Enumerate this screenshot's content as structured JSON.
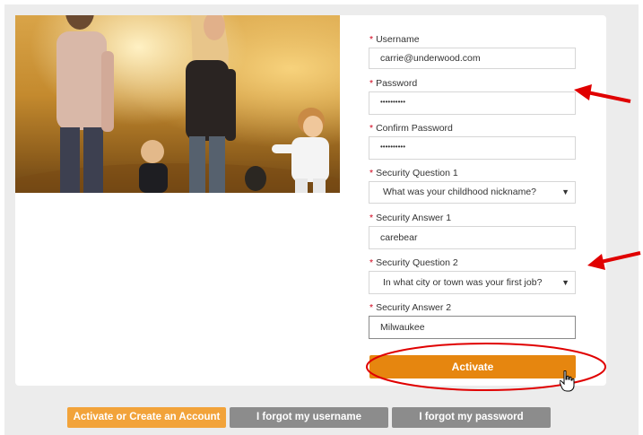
{
  "form": {
    "username": {
      "label": "Username",
      "value": "carrie@underwood.com"
    },
    "password": {
      "label": "Password",
      "value": "••••••••••"
    },
    "confirm_password": {
      "label": "Confirm Password",
      "value": "••••••••••"
    },
    "security_question_1": {
      "label": "Security Question 1",
      "selected": "What was your childhood nickname?"
    },
    "security_answer_1": {
      "label": "Security Answer 1",
      "value": "carebear"
    },
    "security_question_2": {
      "label": "Security Question 2",
      "selected": "In what city or town was your first job?"
    },
    "security_answer_2": {
      "label": "Security Answer 2",
      "value": "Milwaukee"
    },
    "required_marker": "*",
    "submit_label": "Activate"
  },
  "footer_buttons": {
    "activate_or_create": "Activate or Create an Account",
    "forgot_username": "I forgot my username",
    "forgot_password": "I forgot my password"
  },
  "icons": {
    "select_caret": "▼"
  },
  "colors": {
    "accent_orange": "#e6860f",
    "light_orange": "#f2a33a",
    "gray_button": "#8c8c8c",
    "required_red": "#d0021b",
    "annotation_red": "#e00000"
  }
}
